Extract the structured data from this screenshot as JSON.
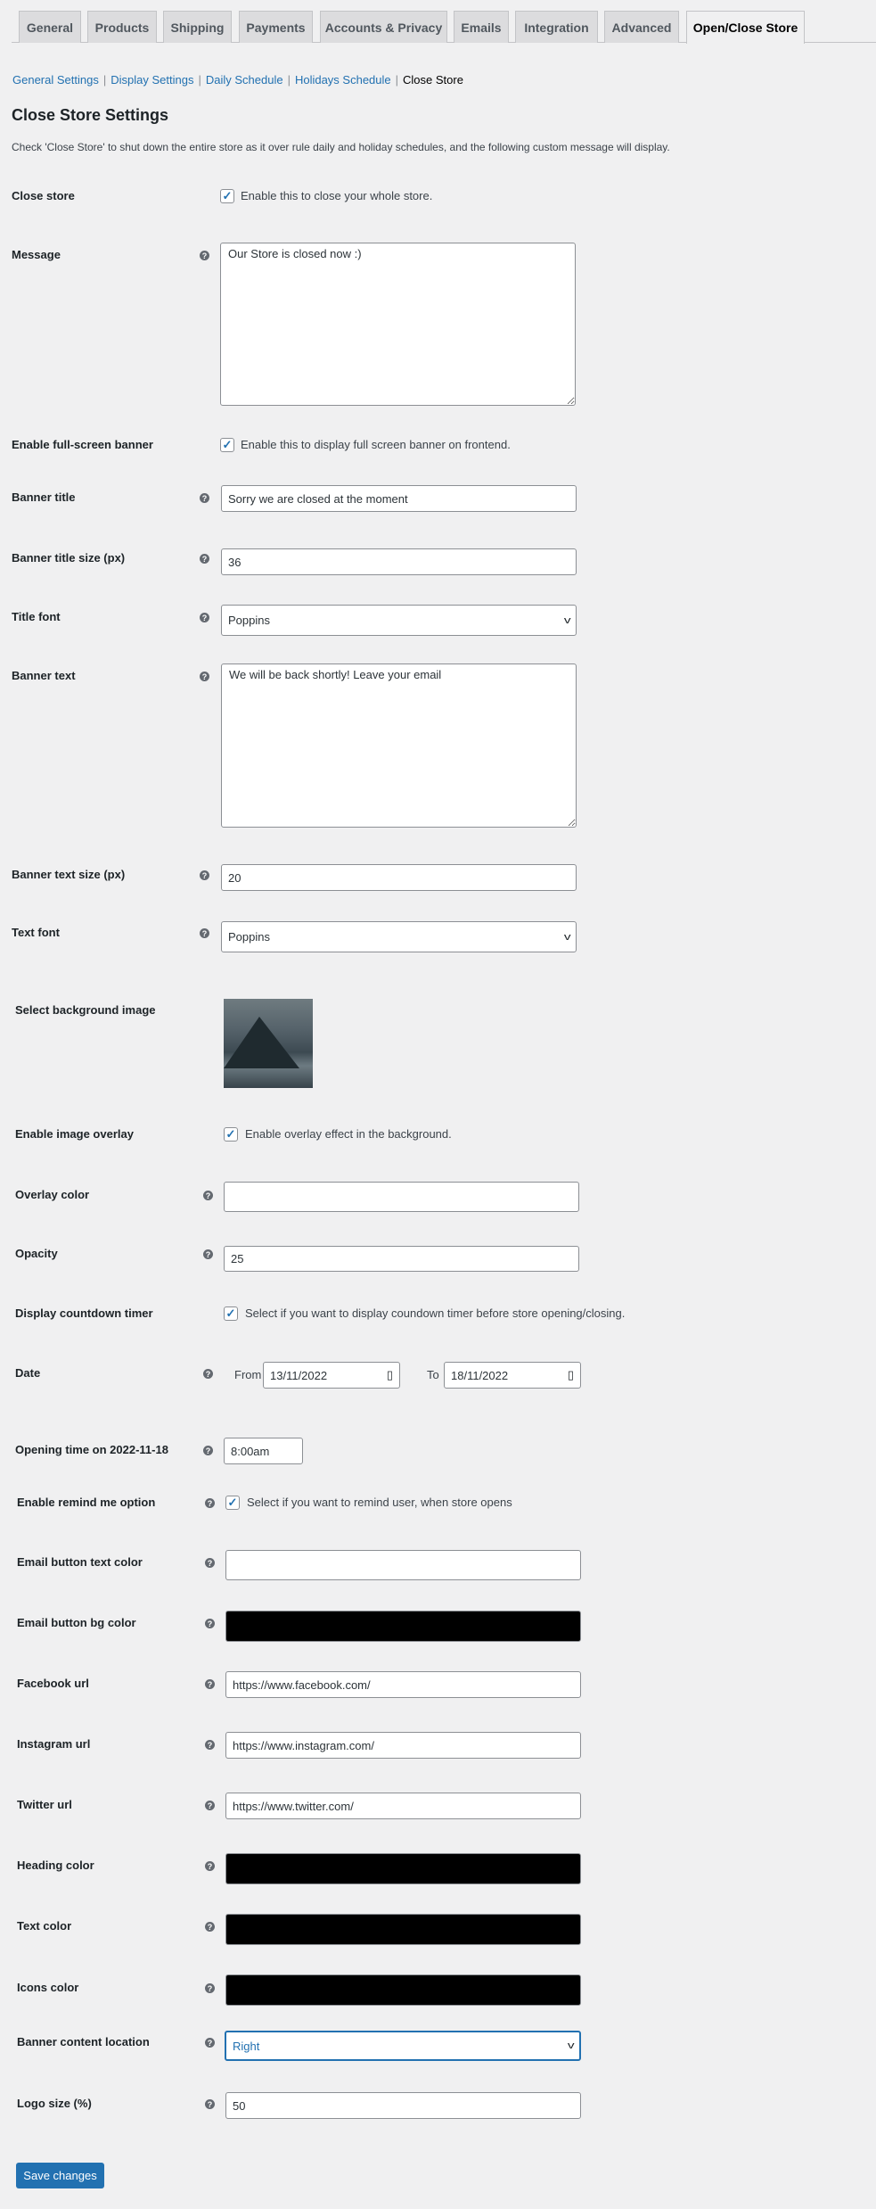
{
  "tabs": [
    "General",
    "Products",
    "Shipping",
    "Payments",
    "Accounts & Privacy",
    "Emails",
    "Integration",
    "Advanced",
    "Open/Close Store"
  ],
  "subnav": [
    "General Settings",
    "Display Settings",
    "Daily Schedule",
    "Holidays Schedule",
    "Close Store"
  ],
  "title": "Close Store Settings",
  "description": "Check 'Close Store' to shut down the entire store as it over rule daily and holiday schedules, and the following custom message will display.",
  "fields": {
    "close_store": {
      "label": "Close store",
      "checked": true,
      "text": "Enable this to close your whole store."
    },
    "message": {
      "label": "Message",
      "value": "Our Store is closed now :)"
    },
    "fullscreen": {
      "label": "Enable full-screen banner",
      "checked": true,
      "text": "Enable this to display full screen banner on frontend."
    },
    "banner_title": {
      "label": "Banner title",
      "value": "Sorry we are closed at the moment"
    },
    "banner_title_size": {
      "label": "Banner title size (px)",
      "value": "36"
    },
    "title_font": {
      "label": "Title font",
      "value": "Poppins"
    },
    "banner_text": {
      "label": "Banner text",
      "value": "We will be back shortly! Leave your email"
    },
    "banner_text_size": {
      "label": "Banner text size (px)",
      "value": "20"
    },
    "text_font": {
      "label": "Text font",
      "value": "Poppins"
    },
    "bg_image": {
      "label": "Select background image"
    },
    "overlay": {
      "label": "Enable image overlay",
      "checked": true,
      "text": "Enable overlay effect in the background."
    },
    "overlay_color": {
      "label": "Overlay color",
      "value": ""
    },
    "opacity": {
      "label": "Opacity",
      "value": "25"
    },
    "countdown": {
      "label": "Display countdown timer",
      "checked": true,
      "text": "Select if you want to display coundown timer before store opening/closing."
    },
    "date": {
      "label": "Date",
      "from_label": "From",
      "from": "13/11/2022",
      "to_label": "To",
      "to": "18/11/2022"
    },
    "opening_time": {
      "label": "Opening time on 2022-11-18",
      "value": "8:00am"
    },
    "remind": {
      "label": "Enable remind me option",
      "checked": true,
      "text": "Select if you want to remind user, when store opens"
    },
    "email_text_color": {
      "label": "Email button text color",
      "value": "#ffffff"
    },
    "email_bg_color": {
      "label": "Email button bg color",
      "value": "#000000"
    },
    "facebook": {
      "label": "Facebook url",
      "value": "https://www.facebook.com/"
    },
    "instagram": {
      "label": "Instagram url",
      "value": "https://www.instagram.com/"
    },
    "twitter": {
      "label": "Twitter url",
      "value": "https://www.twitter.com/"
    },
    "heading_color": {
      "label": "Heading color",
      "value": "#000000"
    },
    "text_color": {
      "label": "Text color",
      "value": "#000000"
    },
    "icons_color": {
      "label": "Icons color",
      "value": "#000000"
    },
    "location": {
      "label": "Banner content location",
      "value": "Right"
    },
    "logo_size": {
      "label": "Logo size (%)",
      "value": "50"
    }
  },
  "save_label": "Save changes",
  "colors": {
    "accent": "#2271b1",
    "background": "#f0f0f1"
  }
}
